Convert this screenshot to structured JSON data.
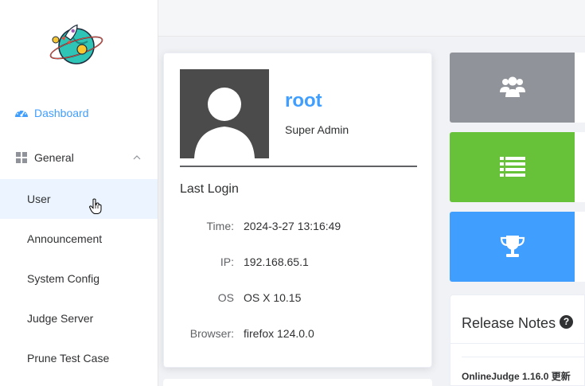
{
  "sidebar": {
    "dashboard_label": "Dashboard",
    "general_label": "General",
    "general_items": [
      "User",
      "Announcement",
      "System Config",
      "Judge Server",
      "Prune Test Case"
    ]
  },
  "profile": {
    "username": "root",
    "role": "Super Admin",
    "last_login_title": "Last Login",
    "fields": [
      {
        "key": "Time:",
        "value": "2024-3-27 13:16:49"
      },
      {
        "key": "IP:",
        "value": "192.168.65.1"
      },
      {
        "key": "OS",
        "value": "OS X 10.15"
      },
      {
        "key": "Browser:",
        "value": "firefox 124.0.0"
      }
    ]
  },
  "tiles": [
    {
      "icon": "users-icon",
      "color": "#909399"
    },
    {
      "icon": "list-icon",
      "color": "#67c23a"
    },
    {
      "icon": "trophy-icon",
      "color": "#409eff"
    }
  ],
  "release_notes": {
    "title": "Release Notes",
    "help_glyph": "?",
    "first_item": "OnlineJudge 1.16.0 更新"
  },
  "colors": {
    "accent": "#409eff",
    "hover_bg": "#ecf5ff"
  }
}
